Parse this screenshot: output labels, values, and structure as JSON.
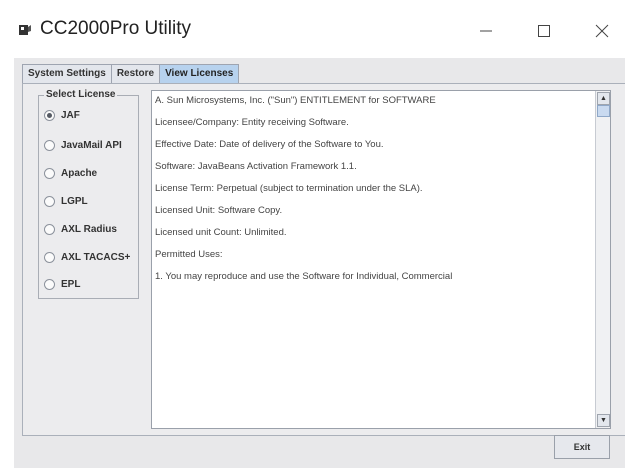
{
  "window": {
    "title": "CC2000Pro Utility",
    "icons": {
      "app": "app-logo-icon",
      "minimize": "minimize-icon",
      "maximize": "maximize-icon",
      "close": "close-icon"
    }
  },
  "tabs": [
    {
      "label": "System Settings",
      "active": false
    },
    {
      "label": "Restore",
      "active": false
    },
    {
      "label": "View Licenses",
      "active": true
    }
  ],
  "license_group": {
    "legend": "Select License",
    "options": [
      {
        "label": "JAF",
        "selected": true
      },
      {
        "label": "JavaMail API",
        "selected": false
      },
      {
        "label": "Apache",
        "selected": false
      },
      {
        "label": "LGPL",
        "selected": false
      },
      {
        "label": "AXL Radius",
        "selected": false
      },
      {
        "label": "AXL TACACS+",
        "selected": false
      },
      {
        "label": "EPL",
        "selected": false
      }
    ]
  },
  "license_text": {
    "paragraphs": [
      "A. Sun Microsystems, Inc. (\"Sun\") ENTITLEMENT for SOFTWARE",
      "Licensee/Company: Entity receiving Software.",
      "Effective Date: Date of delivery of the Software to You.",
      "Software: JavaBeans Activation Framework 1.1.",
      "License Term: Perpetual (subject to termination under the SLA).",
      "Licensed Unit: Software Copy.",
      "Licensed unit Count: Unlimited.",
      "Permitted Uses:",
      "1. You may reproduce and use the Software for Individual, Commercial"
    ]
  },
  "buttons": {
    "exit": "Exit"
  },
  "colors": {
    "active_tab": "#b7d2ee",
    "window_bg": "#e8e8ea"
  }
}
